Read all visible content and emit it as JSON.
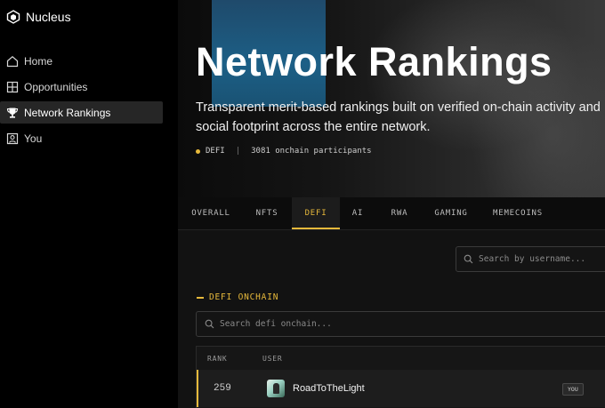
{
  "brand": {
    "name": "Nucleus",
    "icon": "nucleus-logo-icon"
  },
  "sidebar": {
    "items": [
      {
        "label": "Home",
        "icon": "home-icon",
        "active": false
      },
      {
        "label": "Opportunities",
        "icon": "grid-icon",
        "active": false
      },
      {
        "label": "Network Rankings",
        "icon": "trophy-icon",
        "active": true
      },
      {
        "label": "You",
        "icon": "user-icon",
        "active": false
      }
    ]
  },
  "hero": {
    "title": "Network Rankings",
    "subtitle": "Transparent merit-based rankings built on verified on-chain activity and social footprint across the entire network.",
    "meta_category": "DEFI",
    "meta_separator": "|",
    "meta_participants": "3081 onchain participants"
  },
  "tabs": [
    {
      "label": "OVERALL",
      "active": false
    },
    {
      "label": "NFTS",
      "active": false
    },
    {
      "label": "DEFI",
      "active": true
    },
    {
      "label": "AI",
      "active": false
    },
    {
      "label": "RWA",
      "active": false
    },
    {
      "label": "GAMING",
      "active": false
    },
    {
      "label": "MEMECOINS",
      "active": false
    }
  ],
  "search_top": {
    "placeholder": "Search by username..."
  },
  "section": {
    "label": "DEFI ONCHAIN"
  },
  "search_inline": {
    "placeholder": "Search defi onchain..."
  },
  "table": {
    "columns": {
      "rank": "RANK",
      "user": "USER"
    },
    "rows": [
      {
        "rank": "259",
        "username": "RoadToTheLight",
        "badge": "YOU"
      }
    ]
  },
  "colors": {
    "accent": "#e7b93b",
    "background": "#000000",
    "panel": "#121212"
  }
}
